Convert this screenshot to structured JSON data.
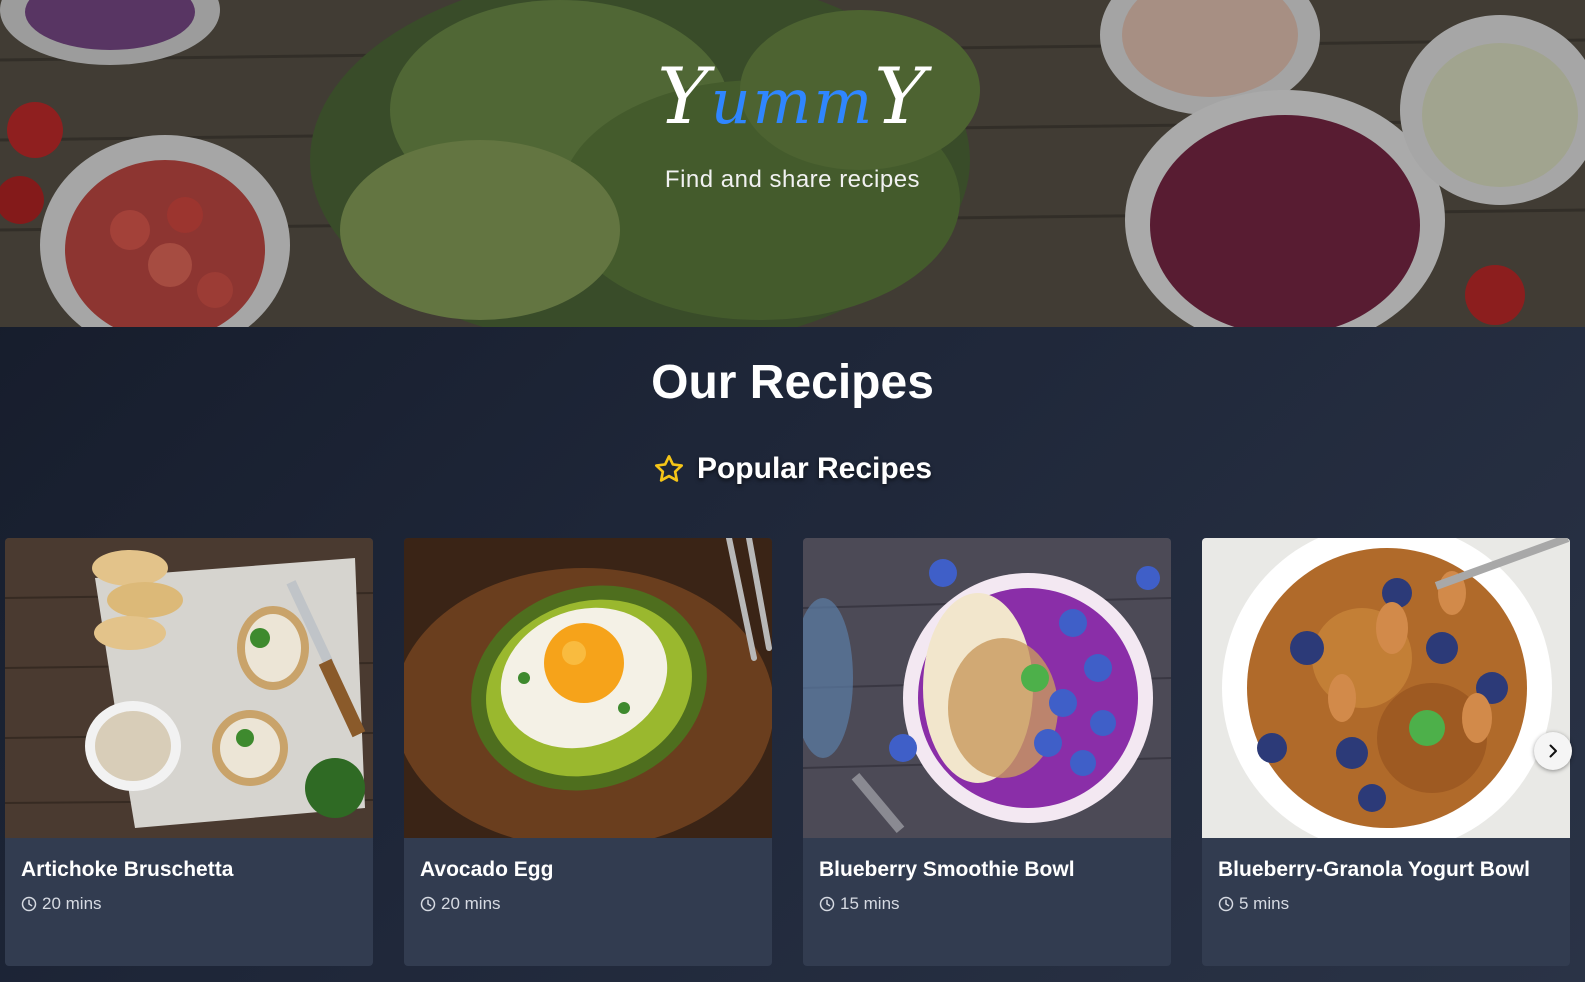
{
  "hero": {
    "logo_first": "Y",
    "logo_middle": "umm",
    "logo_last": "Y",
    "tagline": "Find and share recipes"
  },
  "section": {
    "title": "Our Recipes",
    "subtitle": "Popular Recipes",
    "subtitle_icon": "star-icon"
  },
  "colors": {
    "logo_accent": "#2f86ff",
    "star": "#f5c518",
    "card_background": "#323c50"
  },
  "recipes": [
    {
      "title": "Artichoke Bruschetta",
      "time": "20 mins",
      "time_icon": "clock-icon"
    },
    {
      "title": "Avocado Egg",
      "time": "20 mins",
      "time_icon": "clock-icon"
    },
    {
      "title": "Blueberry Smoothie Bowl",
      "time": "15 mins",
      "time_icon": "clock-icon"
    },
    {
      "title": "Blueberry-Granola Yogurt Bowl",
      "time": "5 mins",
      "time_icon": "clock-icon"
    }
  ],
  "carousel": {
    "next_icon": "chevron-right-icon"
  }
}
